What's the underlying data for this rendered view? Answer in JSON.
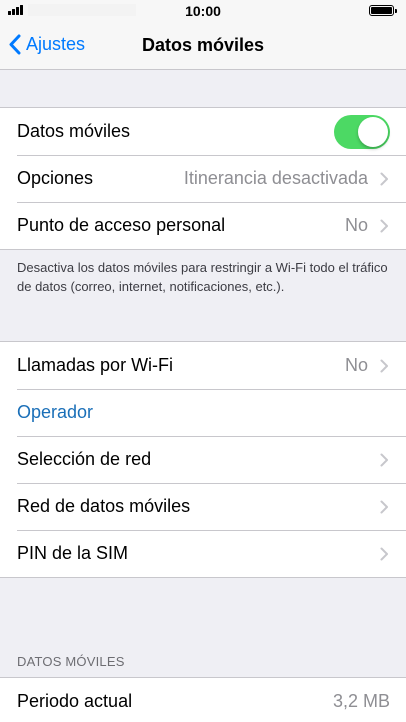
{
  "status_bar": {
    "time": "10:00"
  },
  "nav": {
    "back_label": "Ajustes",
    "title": "Datos móviles"
  },
  "group1": {
    "mobile_data_label": "Datos móviles",
    "mobile_data_on": true,
    "options_label": "Opciones",
    "options_value": "Itinerancia desactivada",
    "hotspot_label": "Punto de acceso personal",
    "hotspot_value": "No"
  },
  "group1_footer": "Desactiva los datos móviles para restringir a Wi-Fi todo el tráfico de datos (correo, internet, notificaciones, etc.).",
  "group2": {
    "wifi_calling_label": "Llamadas por Wi-Fi",
    "wifi_calling_value": "No",
    "carrier_label": "Operador",
    "network_selection_label": "Selección de red",
    "cellular_data_network_label": "Red de datos móviles",
    "sim_pin_label": "PIN de la SIM"
  },
  "usage_section": {
    "header": "DATOS MÓVILES",
    "current_period_label": "Periodo actual",
    "current_period_value": "3,2 MB"
  },
  "colors": {
    "accent": "#007aff",
    "toggle_on": "#4cd964",
    "background": "#efeff4"
  }
}
